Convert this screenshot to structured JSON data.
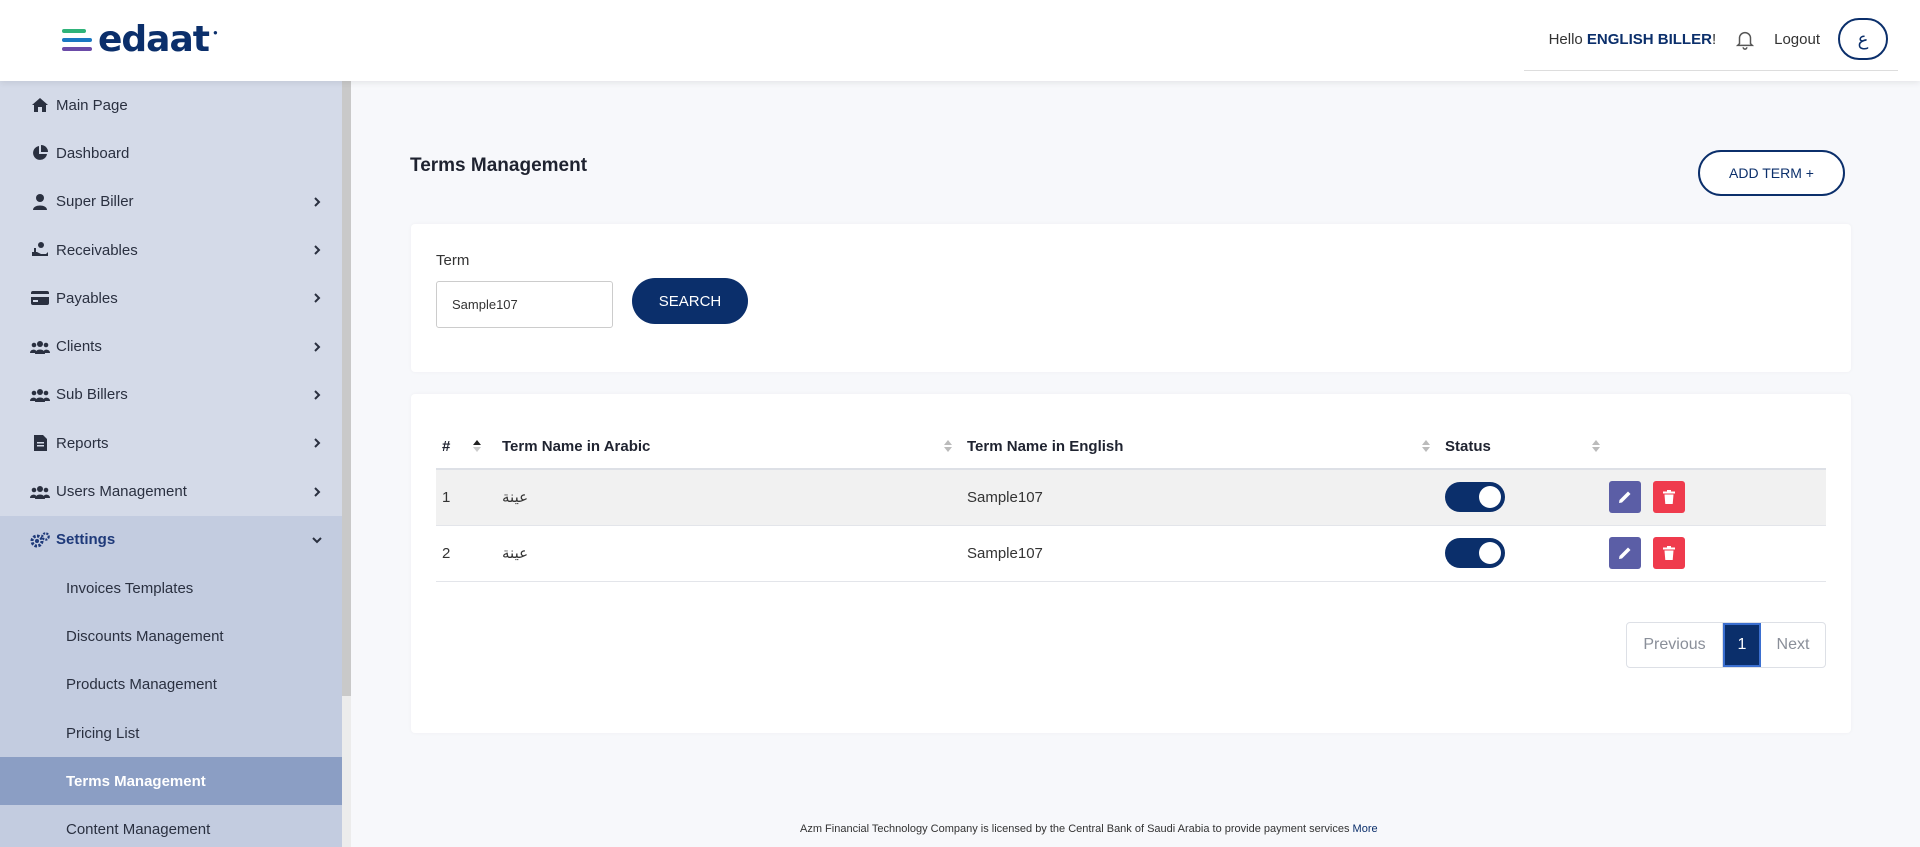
{
  "header": {
    "logo_text": "edaat",
    "greeting": "Hello",
    "user_name": "ENGLISH BILLER",
    "greeting_suffix": "!",
    "logout_label": "Logout",
    "language_toggle": "ع"
  },
  "sidebar": {
    "items": [
      {
        "label": "Main Page",
        "icon": "home-icon"
      },
      {
        "label": "Dashboard",
        "icon": "pie-chart-icon"
      },
      {
        "label": "Super Biller",
        "icon": "user-icon"
      },
      {
        "label": "Receivables",
        "icon": "hand-coin-icon"
      },
      {
        "label": "Payables",
        "icon": "credit-card-icon"
      },
      {
        "label": "Clients",
        "icon": "users-icon"
      },
      {
        "label": "Sub Billers",
        "icon": "users-icon"
      },
      {
        "label": "Reports",
        "icon": "report-icon"
      },
      {
        "label": "Users Management",
        "icon": "users-icon"
      },
      {
        "label": "Settings",
        "icon": "gears-icon"
      }
    ],
    "settings_subitems": [
      "Invoices Templates",
      "Discounts Management",
      "Products Management",
      "Pricing List",
      "Terms Management",
      "Content Management"
    ],
    "active_subitem": "Terms Management"
  },
  "main": {
    "title": "Terms Management",
    "add_button": "ADD TERM +",
    "search": {
      "label": "Term",
      "value": "Sample107",
      "button": "SEARCH"
    },
    "table": {
      "columns": [
        "#",
        "Term Name in Arabic",
        "Term Name in English",
        "Status",
        ""
      ],
      "rows": [
        {
          "index": "1",
          "arabic": "عينة",
          "english": "Sample107",
          "status_on": true
        },
        {
          "index": "2",
          "arabic": "عينة",
          "english": "Sample107",
          "status_on": true
        }
      ]
    },
    "pagination": {
      "previous": "Previous",
      "current": "1",
      "next": "Next"
    }
  },
  "footer": {
    "text": "Azm Financial Technology Company is licensed by the Central Bank of Saudi Arabia to provide payment services",
    "link": "More"
  },
  "colors": {
    "brand": "#0b2f6b",
    "sidebar_bg": "#d4dae8",
    "active_item": "#8b9ec4",
    "edit": "#5b5ea6",
    "delete": "#ef3b4d"
  }
}
